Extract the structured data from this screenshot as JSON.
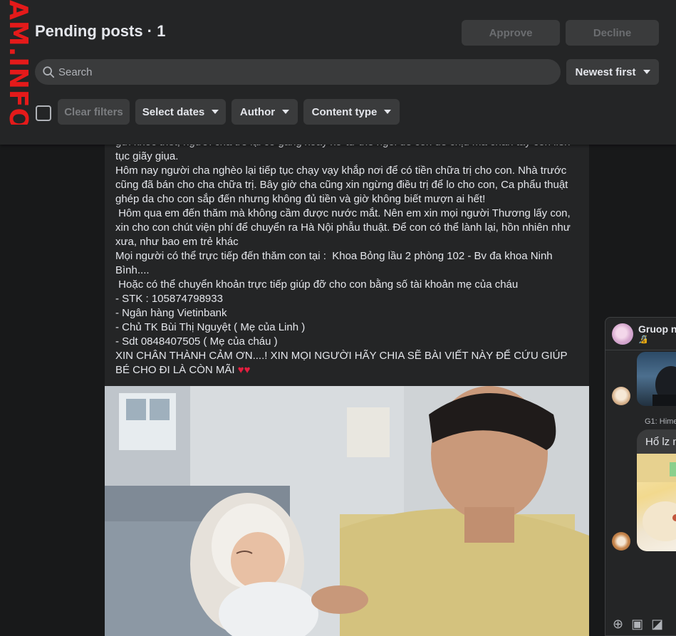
{
  "watermark": "AM.INFO",
  "header": {
    "title": "Pending posts · 1",
    "approve_label": "Approve",
    "decline_label": "Decline"
  },
  "search": {
    "placeholder": "Search",
    "icon": "search-icon"
  },
  "sort": {
    "label": "Newest first",
    "icon": "caret-down-icon"
  },
  "filters": {
    "clear_label": "Clear filters",
    "dates_label": "Select dates",
    "author_label": "Author",
    "content_type_label": "Content type"
  },
  "post": {
    "lines": [
      "gửi khóc thét, người cha trẻ lại cố gắng xoay xở tư thế ngồi để con dễ chịu mà chân tay con liên tục giãy giụa.",
      "Hôm nay người cha nghèo lại tiếp tục chạy vạy khắp nơi để có tiền chữa trị cho con. Nhà trước cũng đã bán cho cha chữa trị. Bây giờ cha cũng xin ngừng điều trị để lo cho con, Ca phẩu thuật ghép da cho con sắp đến nhưng không đủ tiền và giờ không biết mượn ai hết!",
      " Hôm qua em đến thăm mà không cầm được nước mắt. Nên em xin mọi người Thương lấy con, xin cho con chút viện phí để chuyển ra Hà Nội phẫu thuật. Để con có thể lành lại, hồn nhiên như xưa, như bao em trẻ khác",
      "Mọi người có thể trực tiếp đến thăm con tại :  Khoa Bỏng lầu 2 phòng 102 - Bv đa khoa Ninh Bình....",
      " Hoặc có thể chuyển khoản trực tiếp giúp đỡ cho con bằng số tài khoản mẹ của cháu",
      "- STK : 105874798933",
      "- Ngân hàng Vietinbank",
      "- Chủ TK Bùi Thị Nguyệt ( Mẹ của Linh )",
      "- Sdt 0848407505 ( Mẹ của cháu )"
    ],
    "closing": "XIN CHÂN THÀNH CẢM ƠN....! XIN MỌI NGƯỜI HÃY CHIA SẼ BÀI VIẾT NÀY ĐỂ CỨU GIÚP BÉ CHO ĐI LÀ CÒN MÃI ",
    "hearts": "♥♥"
  },
  "chat": {
    "title": "Gruop n",
    "subtitle": "🔏",
    "sender": "G1: Hime",
    "bubble_text": "Hổ lz n",
    "footer_icons": [
      "add-icon",
      "image-icon",
      "sticker-icon"
    ]
  },
  "colors": {
    "background": "#18191a",
    "panel": "#242526",
    "button": "#3a3b3c",
    "text": "#e4e6eb",
    "muted": "#b0b3b8",
    "watermark": "#e41a1a"
  }
}
